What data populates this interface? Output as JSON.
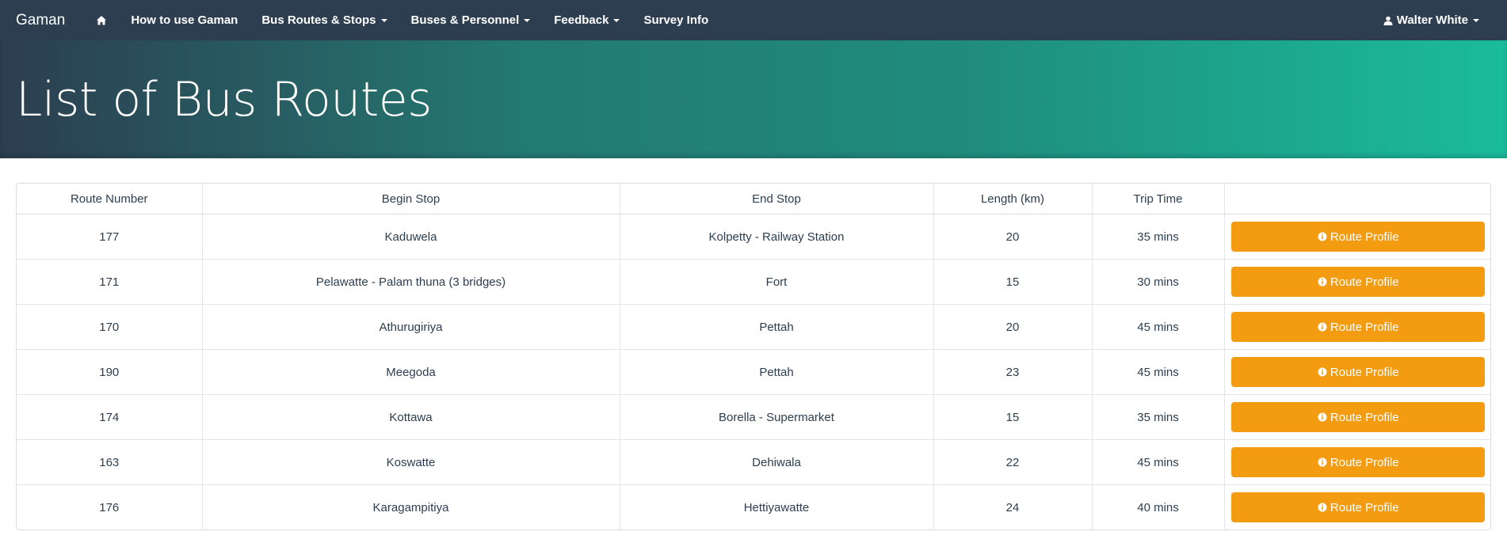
{
  "navbar": {
    "brand": "Gaman",
    "items": [
      {
        "label": "How to use Gaman",
        "dropdown": false
      },
      {
        "label": "Bus Routes & Stops",
        "dropdown": true
      },
      {
        "label": "Buses & Personnel",
        "dropdown": true
      },
      {
        "label": "Feedback",
        "dropdown": true
      },
      {
        "label": "Survey Info",
        "dropdown": false
      }
    ],
    "user": "Walter White"
  },
  "header": {
    "title": "List of Bus Routes"
  },
  "table": {
    "columns": [
      "Route Number",
      "Begin Stop",
      "End Stop",
      "Length (km)",
      "Trip Time",
      ""
    ],
    "button_label": "Route Profile",
    "rows": [
      {
        "route": "177",
        "begin": "Kaduwela",
        "end": "Kolpetty - Railway Station",
        "length": "20",
        "time": "35 mins"
      },
      {
        "route": "171",
        "begin": "Pelawatte - Palam thuna (3 bridges)",
        "end": "Fort",
        "length": "15",
        "time": "30 mins"
      },
      {
        "route": "170",
        "begin": "Athurugiriya",
        "end": "Pettah",
        "length": "20",
        "time": "45 mins"
      },
      {
        "route": "190",
        "begin": "Meegoda",
        "end": "Pettah",
        "length": "23",
        "time": "45 mins"
      },
      {
        "route": "174",
        "begin": "Kottawa",
        "end": "Borella - Supermarket",
        "length": "15",
        "time": "35 mins"
      },
      {
        "route": "163",
        "begin": "Koswatte",
        "end": "Dehiwala",
        "length": "22",
        "time": "45 mins"
      },
      {
        "route": "176",
        "begin": "Karagampitiya",
        "end": "Hettiyawatte",
        "length": "24",
        "time": "40 mins"
      }
    ]
  },
  "colors": {
    "navbar": "#2c3e50",
    "accent": "#1abc9c",
    "button": "#f39c12"
  },
  "icons": {
    "home": "home-icon",
    "user": "user-icon",
    "info": "info-circle-icon"
  }
}
